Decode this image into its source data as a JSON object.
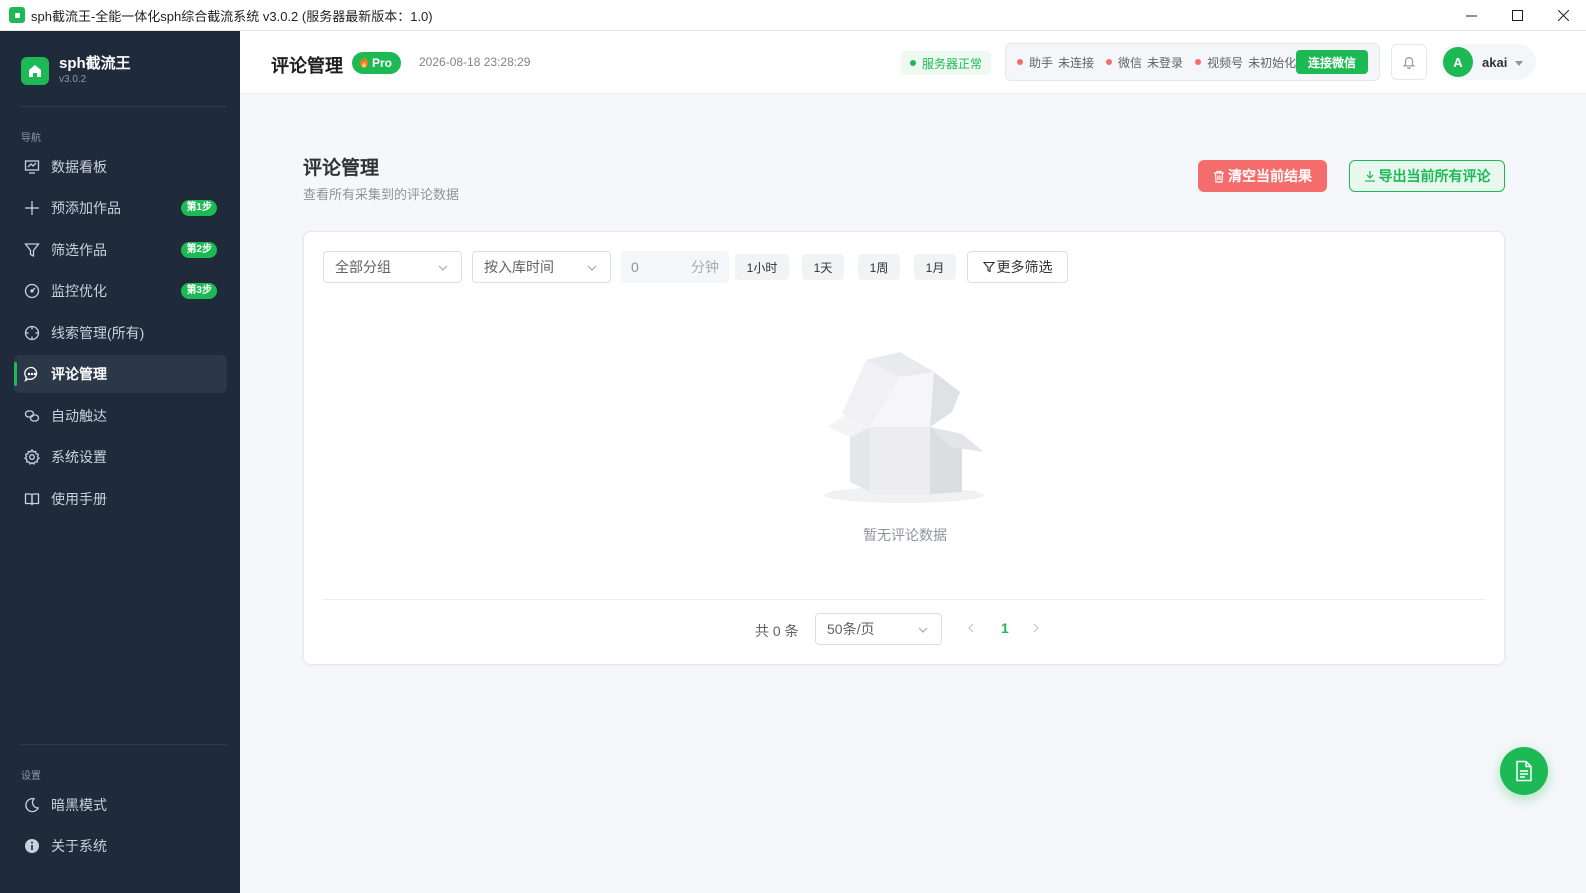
{
  "window": {
    "title": "sph截流王-全能一体化sph综合截流系统 v3.0.2 (服务器最新版本：1.0)"
  },
  "sidebar": {
    "brand_name": "sph截流王",
    "brand_version": "v3.0.2",
    "nav_section": "导航",
    "items": [
      {
        "label": "数据看板",
        "icon": "chart-board-icon"
      },
      {
        "label": "预添加作品",
        "icon": "plus-icon",
        "badge": "第1步"
      },
      {
        "label": "筛选作品",
        "icon": "filter-icon",
        "badge": "第2步"
      },
      {
        "label": "监控优化",
        "icon": "gauge-icon",
        "badge": "第3步"
      },
      {
        "label": "线索管理(所有)",
        "icon": "crosshair-icon"
      },
      {
        "label": "评论管理",
        "icon": "chat-icon",
        "active": true
      },
      {
        "label": "自动触达",
        "icon": "link-icon"
      },
      {
        "label": "系统设置",
        "icon": "gear-icon"
      },
      {
        "label": "使用手册",
        "icon": "book-icon"
      }
    ],
    "settings_section": "设置",
    "bottom_items": [
      {
        "label": "暗黑模式",
        "icon": "moon-icon"
      },
      {
        "label": "关于系统",
        "icon": "info-icon"
      }
    ]
  },
  "header": {
    "title": "评论管理",
    "pro_label": "Pro",
    "datetime": "2026-08-18 23:28:29",
    "server_status": "服务器正常",
    "assistant_label": "助手",
    "assistant_status": "未连接",
    "wechat_label": "微信",
    "wechat_status": "未登录",
    "channel_label": "视频号",
    "channel_status": "未初始化",
    "connect_button": "连接微信",
    "user_initial": "A",
    "user_name": "akai"
  },
  "main": {
    "title": "评论管理",
    "subtitle": "查看所有采集到的评论数据",
    "clear_button": "清空当前结果",
    "export_button": "导出当前所有评论"
  },
  "filters": {
    "group_select": "全部分组",
    "sort_select": "按入库时间",
    "minutes_value": "0",
    "minutes_unit": "分钟",
    "quick_ranges": [
      "1小时",
      "1天",
      "1周",
      "1月"
    ],
    "more_filters": "更多筛选"
  },
  "empty_state": {
    "text": "暂无评论数据"
  },
  "pagination": {
    "total_text": "共 0 条",
    "page_size": "50条/页",
    "current_page": "1"
  },
  "colors": {
    "accent": "#1db954",
    "sidebar_bg": "#1f2a3a",
    "danger": "#f56c6c"
  }
}
